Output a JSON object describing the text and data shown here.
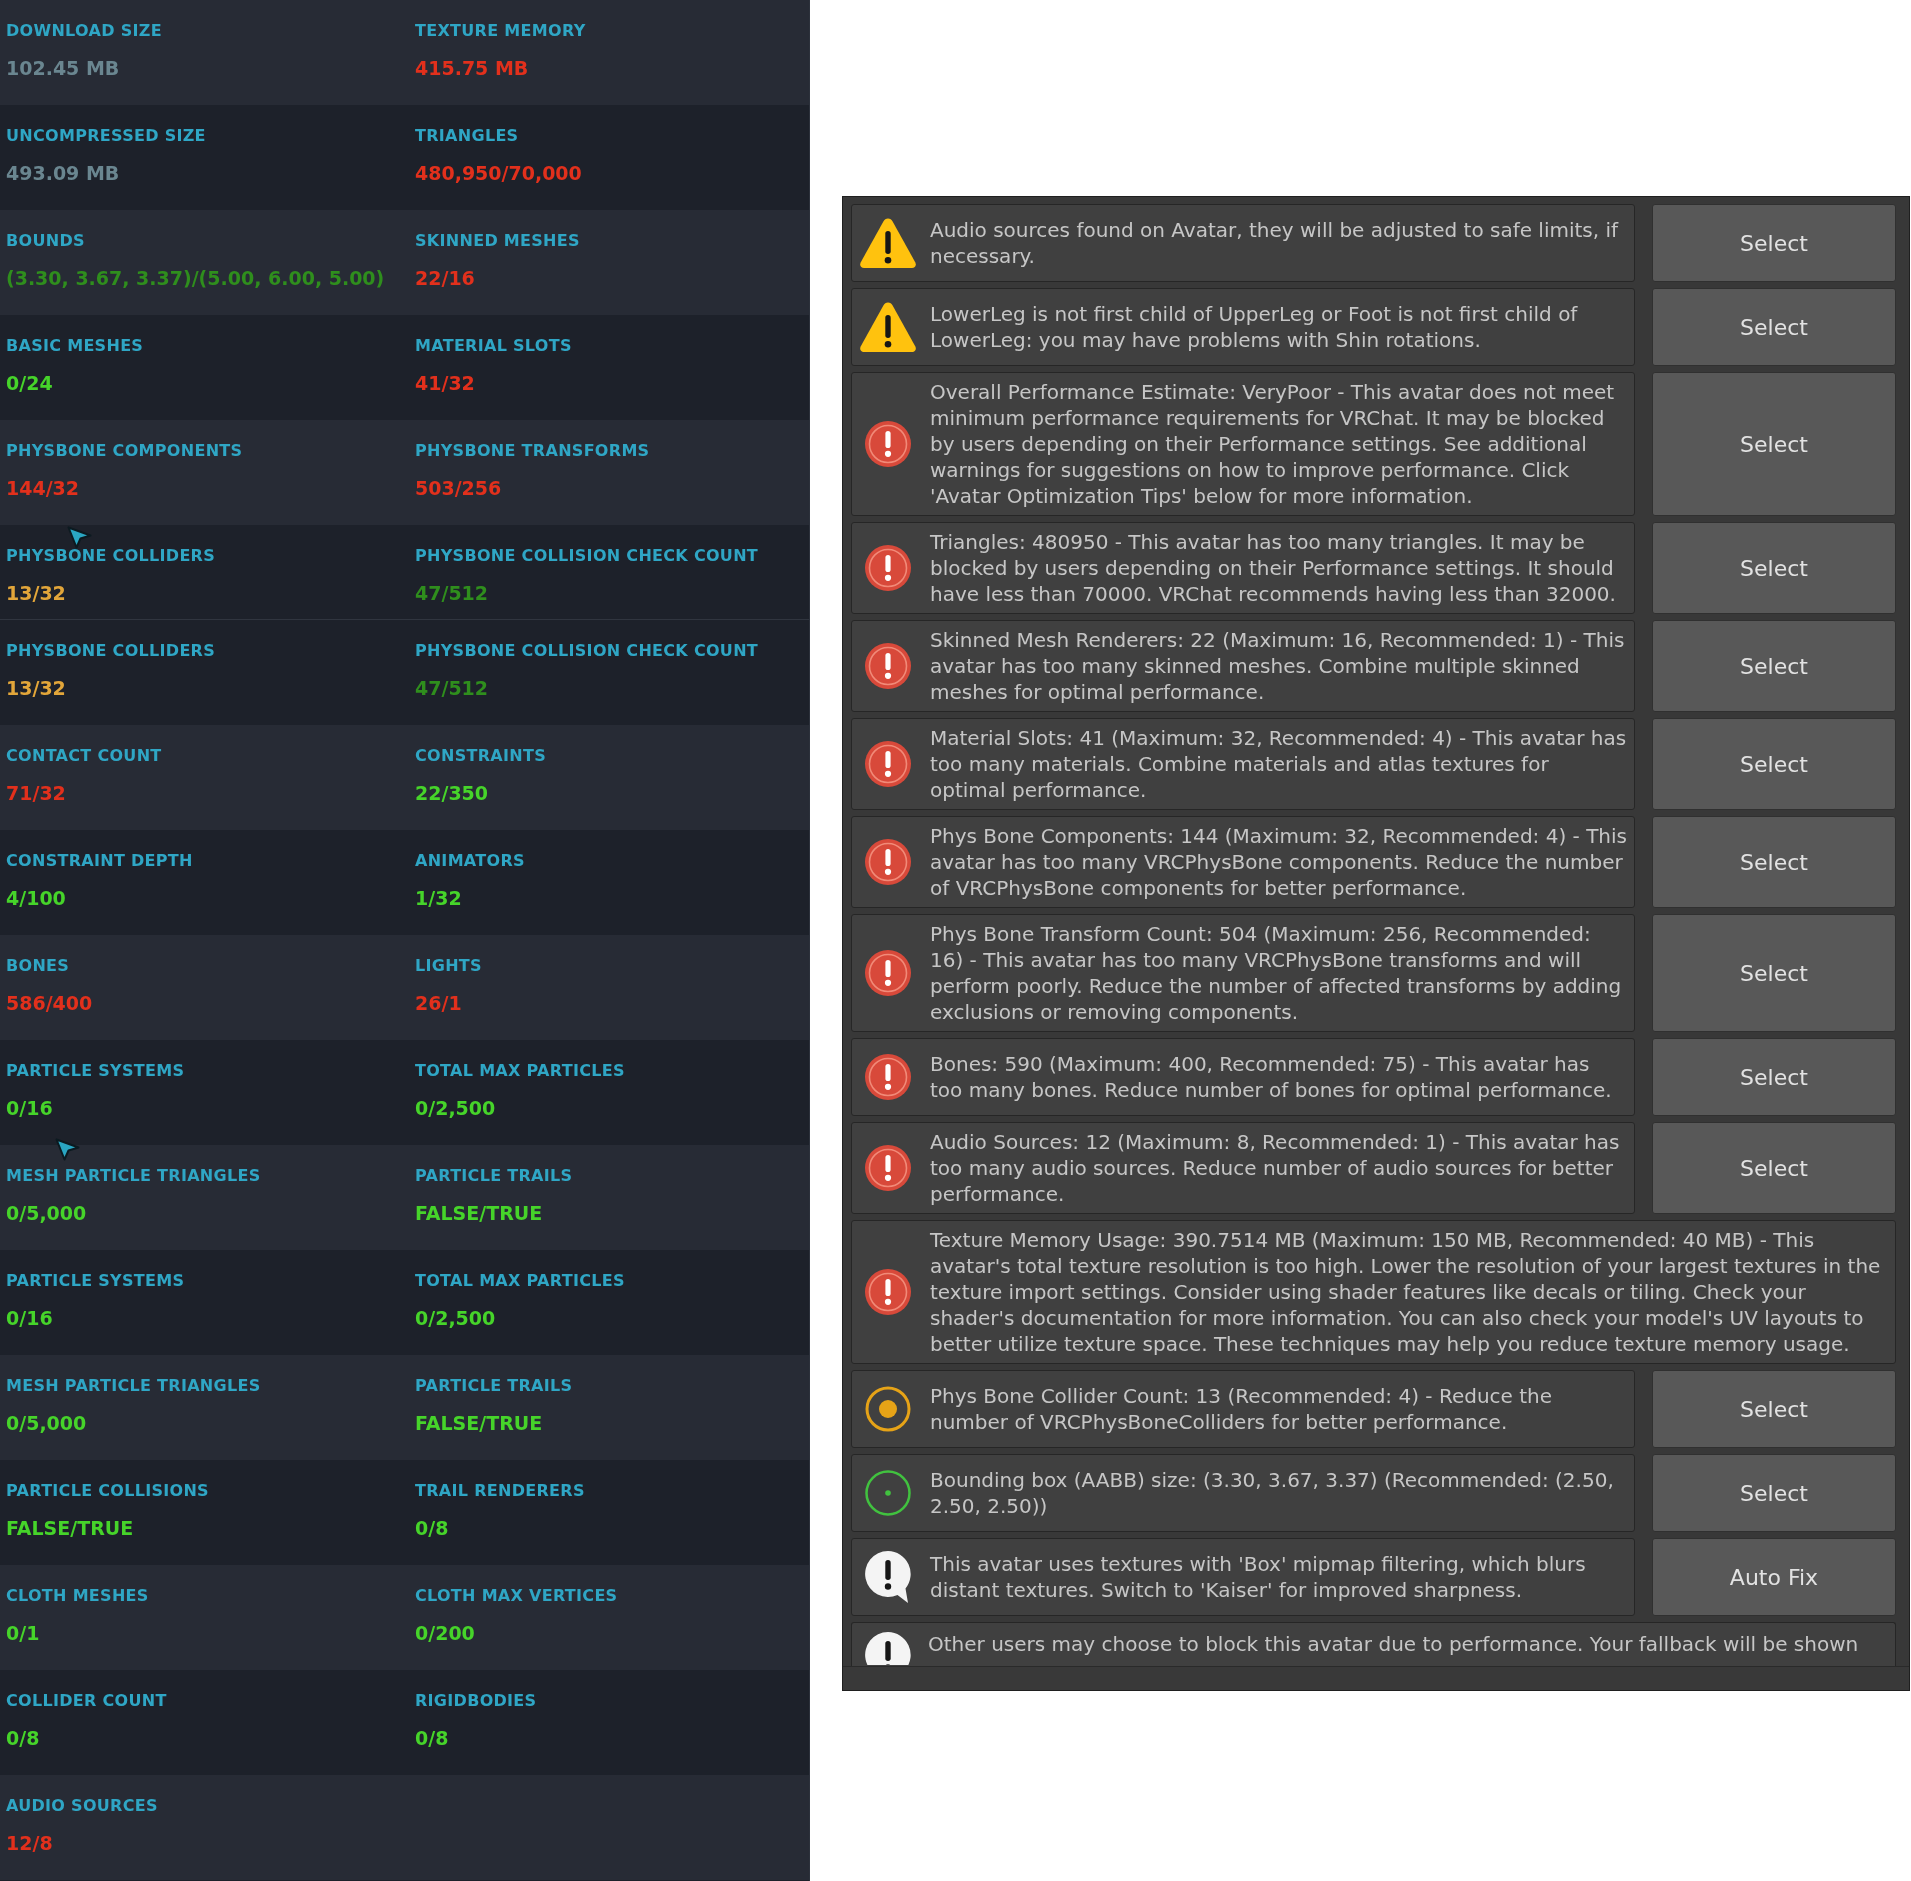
{
  "stats_panels": [
    {
      "rows": [
        {
          "cells": [
            {
              "label": "DOWNLOAD SIZE",
              "value": "102.45 MB",
              "color": "#6a8690"
            },
            {
              "label": "TEXTURE MEMORY",
              "value": "415.75 MB",
              "color": "#e2301c"
            }
          ]
        },
        {
          "cells": [
            {
              "label": "UNCOMPRESSED SIZE",
              "value": "493.09 MB",
              "color": "#6a8690"
            },
            {
              "label": "TRIANGLES",
              "value": "480,950/70,000",
              "color": "#e2301c"
            }
          ]
        },
        {
          "cells": [
            {
              "label": "BOUNDS",
              "value": "(3.30, 3.67, 3.37)/(5.00, 6.00, 5.00)",
              "color": "#2f8e1d"
            },
            {
              "label": "SKINNED MESHES",
              "value": "22/16",
              "color": "#e2301c"
            }
          ]
        },
        {
          "cells": [
            {
              "label": "BASIC MESHES",
              "value": "0/24",
              "color": "#46d42a"
            },
            {
              "label": "MATERIAL SLOTS",
              "value": "41/32",
              "color": "#e2301c"
            }
          ]
        },
        {
          "cells": [
            {
              "label": "PHYSBONE COMPONENTS",
              "value": "144/32",
              "color": "#e2301c"
            },
            {
              "label": "PHYSBONE TRANSFORMS",
              "value": "503/256",
              "color": "#e2301c"
            }
          ]
        },
        {
          "cells": [
            {
              "label": "PHYSBONE COLLIDERS",
              "value": "13/32",
              "color": "#e2a63a"
            },
            {
              "label": "PHYSBONE COLLISION CHECK COUNT",
              "value": "47/512",
              "color": "#2f8e1d"
            }
          ]
        }
      ]
    },
    {
      "rows": [
        {
          "cells": [
            {
              "label": "PHYSBONE COLLIDERS",
              "value": "13/32",
              "color": "#e2a63a"
            },
            {
              "label": "PHYSBONE COLLISION CHECK COUNT",
              "value": "47/512",
              "color": "#2f8e1d"
            }
          ]
        },
        {
          "cells": [
            {
              "label": "CONTACT COUNT",
              "value": "71/32",
              "color": "#e2301c"
            },
            {
              "label": "CONSTRAINTS",
              "value": "22/350",
              "color": "#46d42a"
            }
          ]
        },
        {
          "cells": [
            {
              "label": "CONSTRAINT DEPTH",
              "value": "4/100",
              "color": "#46d42a"
            },
            {
              "label": "ANIMATORS",
              "value": "1/32",
              "color": "#46d42a"
            }
          ]
        },
        {
          "cells": [
            {
              "label": "BONES",
              "value": "586/400",
              "color": "#e2301c"
            },
            {
              "label": "LIGHTS",
              "value": "26/1",
              "color": "#e2301c"
            }
          ]
        },
        {
          "cells": [
            {
              "label": "PARTICLE SYSTEMS",
              "value": "0/16",
              "color": "#46d42a"
            },
            {
              "label": "TOTAL MAX PARTICLES",
              "value": "0/2,500",
              "color": "#46d42a"
            }
          ]
        },
        {
          "cells": [
            {
              "label": "MESH PARTICLE TRIANGLES",
              "value": "0/5,000",
              "color": "#46d42a"
            },
            {
              "label": "PARTICLE TRAILS",
              "value": "FALSE/TRUE",
              "color": "#46d42a"
            }
          ]
        },
        {
          "cells": [
            {
              "label": "PARTICLE SYSTEMS",
              "value": "0/16",
              "color": "#46d42a"
            },
            {
              "label": "TOTAL MAX PARTICLES",
              "value": "0/2,500",
              "color": "#46d42a"
            }
          ]
        },
        {
          "cells": [
            {
              "label": "MESH PARTICLE TRIANGLES",
              "value": "0/5,000",
              "color": "#46d42a"
            },
            {
              "label": "PARTICLE TRAILS",
              "value": "FALSE/TRUE",
              "color": "#46d42a"
            }
          ]
        },
        {
          "cells": [
            {
              "label": "PARTICLE COLLISIONS",
              "value": "FALSE/TRUE",
              "color": "#46d42a"
            },
            {
              "label": "TRAIL RENDERERS",
              "value": "0/8",
              "color": "#46d42a"
            }
          ]
        },
        {
          "cells": [
            {
              "label": "CLOTH MESHES",
              "value": "0/1",
              "color": "#46d42a"
            },
            {
              "label": "CLOTH MAX VERTICES",
              "value": "0/200",
              "color": "#46d42a"
            }
          ]
        },
        {
          "cells": [
            {
              "label": "COLLIDER COUNT",
              "value": "0/8",
              "color": "#46d42a"
            },
            {
              "label": "RIGIDBODIES",
              "value": "0/8",
              "color": "#46d42a"
            }
          ]
        },
        {
          "cells": [
            {
              "label": "AUDIO SOURCES",
              "value": "12/8",
              "color": "#e2301c"
            }
          ]
        }
      ]
    }
  ],
  "validation_panel": {
    "messages": [
      {
        "kind": "warning",
        "text": "Audio sources found on Avatar, they will be adjusted to safe limits, if necessary.",
        "button": "Select"
      },
      {
        "kind": "warning",
        "text": "LowerLeg is not first child of UpperLeg or Foot is not first child of LowerLeg: you may have problems with Shin rotations.",
        "button": "Select"
      },
      {
        "kind": "error",
        "text": "Overall Performance Estimate: VeryPoor - This avatar does not meet minimum performance requirements for VRChat. It may be blocked by users depending on their Performance settings. See additional warnings for suggestions on how to improve performance. Click 'Avatar Optimization Tips' below for more information.",
        "button": "Select"
      },
      {
        "kind": "error",
        "text": "Triangles: 480950 - This avatar has too many triangles. It may be blocked by users depending on their Performance settings. It should have less than 70000. VRChat recommends having less than 32000.",
        "button": "Select"
      },
      {
        "kind": "error",
        "text": "Skinned Mesh Renderers: 22 (Maximum: 16, Recommended: 1) - This avatar has too many skinned meshes. Combine multiple skinned meshes for optimal performance.",
        "button": "Select"
      },
      {
        "kind": "error",
        "text": "Material Slots: 41 (Maximum: 32, Recommended: 4) - This avatar has too many materials. Combine materials and atlas textures for optimal performance.",
        "button": "Select"
      },
      {
        "kind": "error",
        "text": "Phys Bone Components: 144 (Maximum: 32, Recommended: 4) - This avatar has too many VRCPhysBone components. Reduce the number of VRCPhysBone components for better performance.",
        "button": "Select"
      },
      {
        "kind": "error",
        "text": "Phys Bone Transform Count: 504 (Maximum: 256, Recommended: 16) - This avatar has too many VRCPhysBone transforms and will perform poorly. Reduce the number of affected transforms by adding exclusions or removing components.",
        "button": "Select"
      },
      {
        "kind": "error",
        "text": "Bones: 590 (Maximum: 400, Recommended: 75) - This avatar has too many bones. Reduce number of bones for optimal performance.",
        "button": "Select"
      },
      {
        "kind": "error",
        "text": "Audio Sources: 12 (Maximum: 8, Recommended: 1) - This avatar has too many audio sources. Reduce number of audio sources for better performance.",
        "button": "Select"
      },
      {
        "kind": "error",
        "text": "Texture Memory Usage: 390.7514 MB (Maximum: 150 MB, Recommended: 40 MB) - This avatar's total texture resolution is too high. Lower the resolution of your largest textures in the texture import settings. Consider using shader features like decals or tiling. Check your shader's documentation for more information. You can also check your model's UV layouts to better utilize texture space. These techniques may help you reduce texture memory usage."
      },
      {
        "kind": "info",
        "text": "Phys Bone Collider Count: 13 (Recommended: 4) - Reduce the number of VRCPhysBoneColliders for better performance.",
        "button": "Select"
      },
      {
        "kind": "good",
        "text": "Bounding box (AABB) size: (3.30, 3.67, 3.37) (Recommended: (2.50, 2.50, 2.50))",
        "button": "Select"
      },
      {
        "kind": "notice",
        "text": "This avatar uses textures with 'Box' mipmap filtering, which blurs distant textures. Switch to 'Kaiser' for improved sharpness.",
        "button": "Auto Fix"
      },
      {
        "kind": "notice",
        "text": "Other users may choose to block this avatar due to performance. Your fallback will be shown"
      }
    ]
  }
}
